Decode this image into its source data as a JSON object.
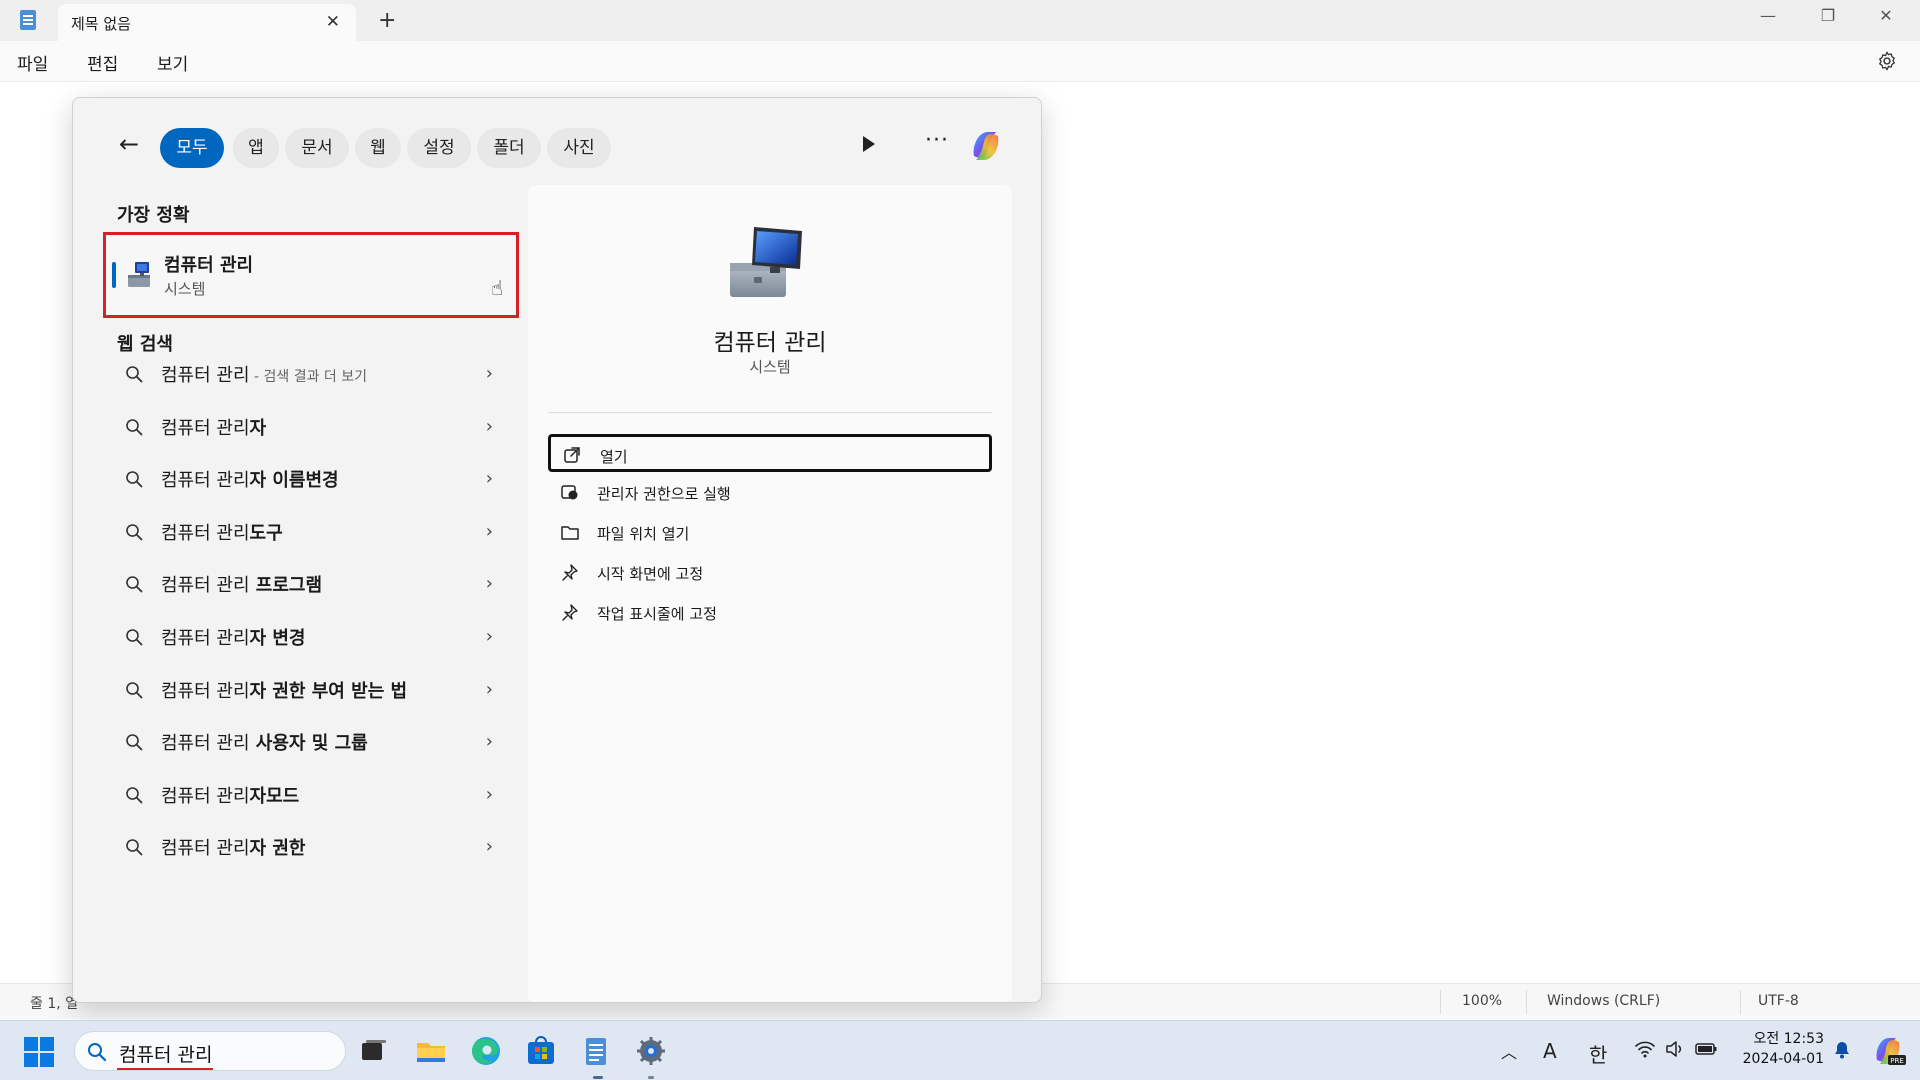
{
  "window": {
    "tab_title": "제목 없음",
    "tab_close": "✕",
    "new_tab": "+",
    "controls": {
      "minimize": "—",
      "maximize": "❐",
      "close": "✕"
    }
  },
  "menu": {
    "file": "파일",
    "edit": "편집",
    "view": "보기"
  },
  "status": {
    "position": "줄 1, 열",
    "zoom": "100%",
    "line_ending": "Windows (CRLF)",
    "encoding": "UTF-8"
  },
  "search": {
    "filters": [
      {
        "label": "모두",
        "active": true
      },
      {
        "label": "앱",
        "active": false
      },
      {
        "label": "문서",
        "active": false
      },
      {
        "label": "웹",
        "active": false
      },
      {
        "label": "설정",
        "active": false
      },
      {
        "label": "폴더",
        "active": false
      },
      {
        "label": "사진",
        "active": false
      }
    ],
    "more_label": "···",
    "best_match_title": "가장 정확",
    "best_match": {
      "name": "컴퓨터 관리",
      "type": "시스템"
    },
    "web_title": "웹 검색",
    "web_results": [
      {
        "base": "컴퓨터 관리",
        "bold": "",
        "suffix": " - 검색 결과 더 보기"
      },
      {
        "base": "컴퓨터 관리",
        "bold": "자",
        "suffix": ""
      },
      {
        "base": "컴퓨터 관리",
        "bold": "자 이름변경",
        "suffix": ""
      },
      {
        "base": "컴퓨터 관리",
        "bold": "도구",
        "suffix": ""
      },
      {
        "base": "컴퓨터 관리",
        "bold": " 프로그램",
        "suffix": ""
      },
      {
        "base": "컴퓨터 관리",
        "bold": "자 변경",
        "suffix": ""
      },
      {
        "base": "컴퓨터 관리",
        "bold": "자 권한 부여 받는 법",
        "suffix": ""
      },
      {
        "base": "컴퓨터 관리",
        "bold": " 사용자 및 그룹",
        "suffix": ""
      },
      {
        "base": "컴퓨터 관리",
        "bold": "자모드",
        "suffix": ""
      },
      {
        "base": "컴퓨터 관리",
        "bold": "자 권한",
        "suffix": ""
      }
    ],
    "detail": {
      "title": "컴퓨터 관리",
      "subtitle": "시스템",
      "actions": [
        {
          "label": "열기",
          "icon": "open-external-icon"
        },
        {
          "label": "관리자 권한으로 실행",
          "icon": "shield-admin-icon"
        },
        {
          "label": "파일 위치 열기",
          "icon": "folder-icon"
        },
        {
          "label": "시작 화면에 고정",
          "icon": "pin-icon"
        },
        {
          "label": "작업 표시줄에 고정",
          "icon": "pin-icon"
        }
      ]
    }
  },
  "taskbar": {
    "search_query": "컴퓨터 관리",
    "clock_period_time": "오전 12:53",
    "date": "2024-04-01",
    "ime_font": "A",
    "ime_lang": "한",
    "accent": "#0067c0",
    "highlight": "#d81f26"
  }
}
